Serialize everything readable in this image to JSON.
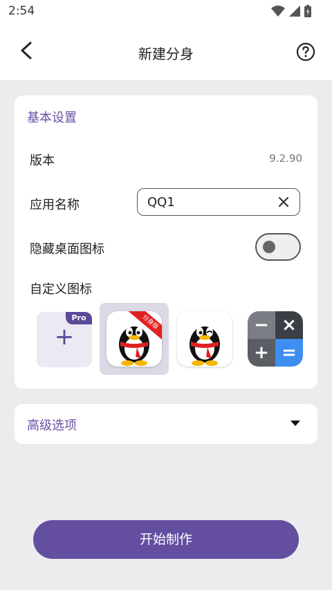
{
  "status_bar": {
    "time": "2:54"
  },
  "header": {
    "title": "新建分身"
  },
  "basic": {
    "section_title": "基本设置",
    "version_label": "版本",
    "version_value": "9.2.90",
    "app_name_label": "应用名称",
    "app_name_value": "QQ1",
    "hide_icon_label": "隐藏桌面图标",
    "hide_icon_enabled": false,
    "custom_icon_label": "自定义图标",
    "pro_badge": "Pro",
    "add_symbol": "+",
    "ribbon_text": "分身版",
    "icons": [
      {
        "name": "add-custom-icon"
      },
      {
        "name": "qq-clone-icon",
        "selected": true
      },
      {
        "name": "qq-original-icon"
      },
      {
        "name": "calculator-icon"
      }
    ],
    "calc_symbols": [
      "−",
      "×",
      "+",
      "="
    ]
  },
  "advanced": {
    "label": "高级选项"
  },
  "action": {
    "start_label": "开始制作"
  },
  "colors": {
    "accent": "#634ea0",
    "section_text": "#6a4fa3",
    "background": "#ececef"
  }
}
